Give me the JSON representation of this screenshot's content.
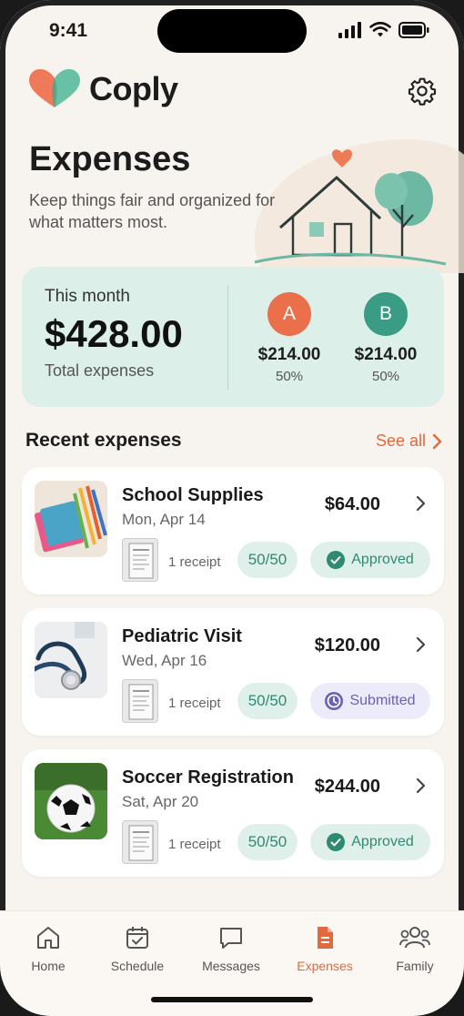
{
  "status_bar": {
    "time": "9:41"
  },
  "app": {
    "name": "Coply"
  },
  "page": {
    "title": "Expenses",
    "subtitle": "Keep things fair and organized for what matters most."
  },
  "summary": {
    "period_label": "This month",
    "total": "$428.00",
    "total_label": "Total expenses",
    "people": [
      {
        "initial": "A",
        "amount": "$214.00",
        "percent": "50%",
        "color": "#e9704a"
      },
      {
        "initial": "B",
        "amount": "$214.00",
        "percent": "50%",
        "color": "#3a9c85"
      }
    ]
  },
  "recent": {
    "title": "Recent expenses",
    "see_all": "See all",
    "items": [
      {
        "title": "School Supplies",
        "date": "Mon, Apr 14",
        "amount": "$64.00",
        "receipts": "1 receipt",
        "split": "50/50",
        "status": "Approved",
        "thumb_icon": "pencils-notebooks"
      },
      {
        "title": "Pediatric Visit",
        "date": "Wed, Apr 16",
        "amount": "$120.00",
        "receipts": "1 receipt",
        "split": "50/50",
        "status": "Submitted",
        "thumb_icon": "stethoscope"
      },
      {
        "title": "Soccer Registration",
        "date": "Sat, Apr 20",
        "amount": "$244.00",
        "receipts": "1 receipt",
        "split": "50/50",
        "status": "Approved",
        "thumb_icon": "soccer-ball"
      }
    ]
  },
  "nav": {
    "items": [
      {
        "label": "Home",
        "icon": "home-icon"
      },
      {
        "label": "Schedule",
        "icon": "calendar-icon"
      },
      {
        "label": "Messages",
        "icon": "message-icon"
      },
      {
        "label": "Expenses",
        "icon": "document-icon",
        "active": true
      },
      {
        "label": "Family",
        "icon": "people-icon"
      }
    ]
  },
  "colors": {
    "accent": "#e0693e",
    "mint": "#dcefe9",
    "teal": "#2f8a72",
    "purple": "#6b5fb8"
  }
}
